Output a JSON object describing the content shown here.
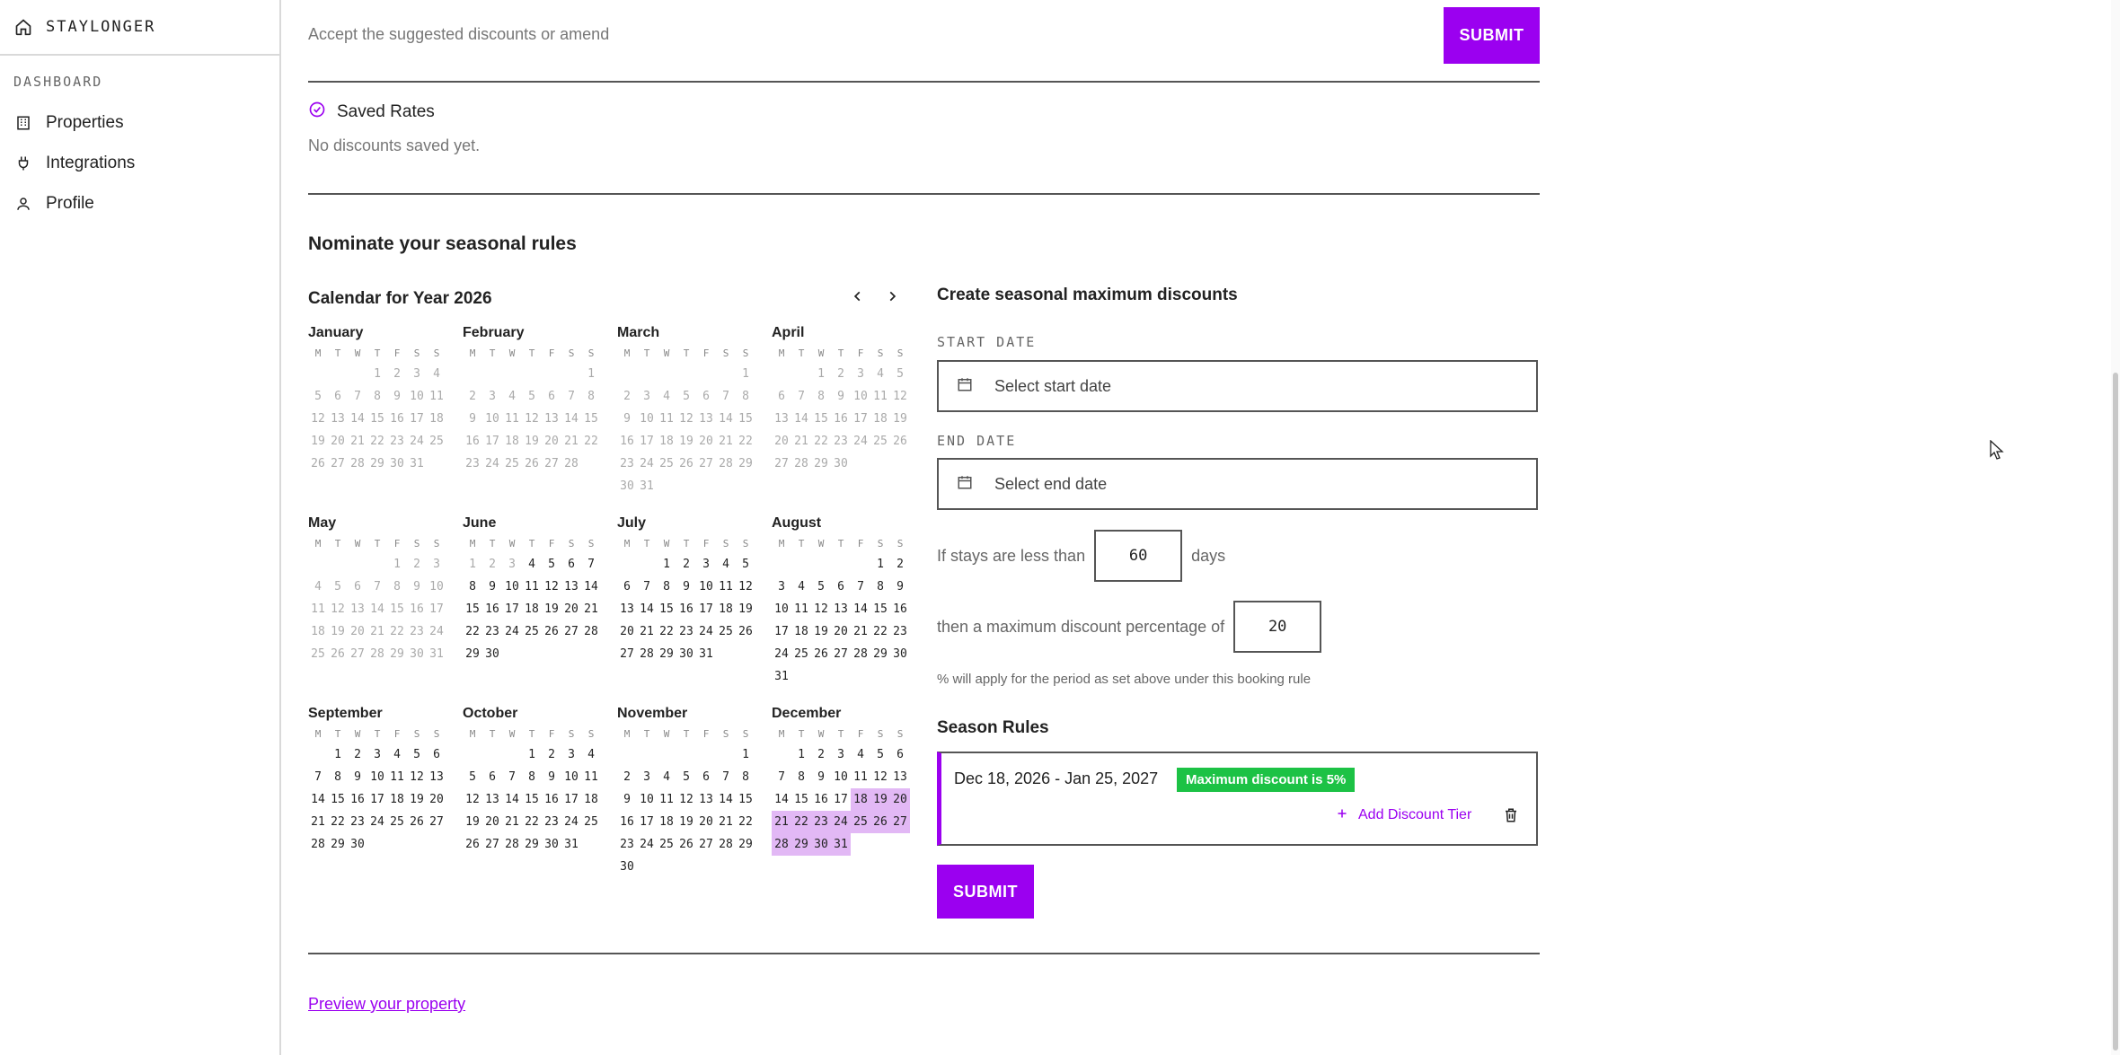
{
  "sidebar": {
    "brand": "STAYLONGER",
    "section": "DASHBOARD",
    "items": [
      {
        "label": "Properties",
        "icon": "building-icon"
      },
      {
        "label": "Integrations",
        "icon": "plug-icon"
      },
      {
        "label": "Profile",
        "icon": "user-icon"
      }
    ]
  },
  "discounts": {
    "instruction": "Accept the suggested discounts or amend",
    "submit_label": "SUBMIT",
    "saved_title": "Saved Rates",
    "saved_empty": "No discounts saved yet."
  },
  "seasonal": {
    "title": "Nominate your seasonal rules",
    "calendar_title": "Calendar for Year 2026",
    "weekdays": [
      "M",
      "T",
      "W",
      "T",
      "F",
      "S",
      "S"
    ],
    "months": [
      {
        "name": "January",
        "offset": 3,
        "days": 31,
        "past_until": 31,
        "selected": []
      },
      {
        "name": "February",
        "offset": 6,
        "days": 28,
        "past_until": 28,
        "selected": []
      },
      {
        "name": "March",
        "offset": 6,
        "days": 31,
        "past_until": 31,
        "selected": []
      },
      {
        "name": "April",
        "offset": 2,
        "days": 30,
        "past_until": 30,
        "selected": []
      },
      {
        "name": "May",
        "offset": 4,
        "days": 31,
        "past_until": 31,
        "selected": []
      },
      {
        "name": "June",
        "offset": 0,
        "days": 30,
        "past_until": 3,
        "selected": []
      },
      {
        "name": "July",
        "offset": 2,
        "days": 31,
        "past_until": 0,
        "selected": []
      },
      {
        "name": "August",
        "offset": 5,
        "days": 31,
        "past_until": 0,
        "selected": []
      },
      {
        "name": "September",
        "offset": 1,
        "days": 30,
        "past_until": 0,
        "selected": []
      },
      {
        "name": "October",
        "offset": 3,
        "days": 31,
        "past_until": 0,
        "selected": []
      },
      {
        "name": "November",
        "offset": 6,
        "days": 30,
        "past_until": 0,
        "selected": []
      },
      {
        "name": "December",
        "offset": 1,
        "days": 31,
        "past_until": 0,
        "selected": [
          18,
          19,
          20,
          21,
          22,
          23,
          24,
          25,
          26,
          27,
          28,
          29,
          30,
          31
        ]
      }
    ]
  },
  "create": {
    "title": "Create seasonal maximum discounts",
    "start_label": "START DATE",
    "start_placeholder": "Select start date",
    "end_label": "END DATE",
    "end_placeholder": "Select end date",
    "stays_prefix": "If stays are less than",
    "stays_value": "60",
    "stays_suffix": "days",
    "discount_prefix": "then a maximum discount percentage of",
    "discount_value": "20",
    "note": "% will apply for the period as set above under this booking rule",
    "rules_title": "Season Rules",
    "rule_range": "Dec 18, 2026 - Jan 25, 2027",
    "rule_badge": "Maximum discount is 5%",
    "add_tier_label": "Add Discount Tier",
    "submit_label": "SUBMIT"
  },
  "footer": {
    "preview_link": "Preview your property"
  },
  "colors": {
    "accent": "#9b00f0",
    "badge_green": "#1cc245",
    "selected_day": "#e2b8f5"
  }
}
